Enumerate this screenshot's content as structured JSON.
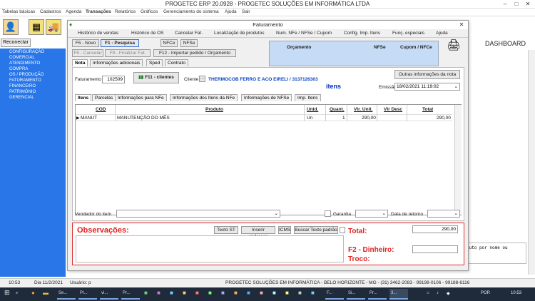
{
  "app": {
    "title": "PROGETEC ERP 20.0928 - PROGETEC SOLUÇÕES EM INFORMÁTICA LTDA",
    "menu": [
      "Tabelas básicas",
      "Cadastros",
      "Agenda",
      "Transações",
      "Relatórios",
      "Gráficos",
      "Gerenciamento do sistema",
      "Ajuda",
      "Sair"
    ],
    "reconnect_label": "Reconectar",
    "modules": [
      "CONFIGURAÇÃO",
      "COMERCIAL",
      "ATENDIMENTO",
      "COMPRA",
      "OS / PRODUÇÃO",
      "FATURAMENTO",
      "FINANCEIRO",
      "PATRIMÔNIO",
      "GERENCIAL"
    ],
    "dashboard_label": "DASHBOARD",
    "search_hint": "duto por nome ou"
  },
  "dialog": {
    "title": "Faturamento",
    "menu": [
      "Histórico de vendas",
      "Histórico de OS",
      "Cancelar Fat.",
      "Localização de produtos",
      "Num. NFe / NFSe / Cupom",
      "Config. Imp. Itens",
      "Funç. especiais",
      "Ajuda"
    ],
    "buttons": {
      "novo": "F5 - Novo",
      "pesquisa": "F1 - Pesquisa",
      "nfce": "NFCe",
      "nfse": "NFSe",
      "cancelar": "F8 - Cancelar",
      "finalizar": "F9 - Finalizar Fat.",
      "importar": "F12 - Importar pedido / Orçamento",
      "clientes": "F11 - clientes",
      "outras_info": "Outras informações da nota",
      "cliente_lookup": "...",
      "texto_st": "Texto ST",
      "inserir_endereco": "Inserir endereço",
      "icms": "ICMS",
      "buscar_texto": "Buscar Texto padrão"
    },
    "summary_headers": [
      "Orçamento",
      "NFSe",
      "Cupom / NFCe"
    ],
    "main_tabs": [
      "Nota",
      "Informações adicionais",
      "Sped",
      "Contrato"
    ],
    "faturamento_label": "Faturamento",
    "faturamento_number": "102509",
    "cliente_label": "Cliente",
    "cliente_name": "THERMOCOB FERRO E ACO EIRELI / 3137126303",
    "itens_title": "itens",
    "emissao_label": "Emissão",
    "emissao_value": "18/02/2021 11:19:02",
    "item_tabs": [
      "Itens",
      "Parcelas",
      "Informações para NFe",
      "Informações dos Itens da NFe",
      "Informações de NFSe",
      "Imp. Itens"
    ],
    "grid": {
      "headers": [
        "COD",
        "Produto",
        "Unid.",
        "Quant.",
        "Vlr. Unit.",
        "Vlr Desc",
        "Total"
      ],
      "row": {
        "cod": "MANUT",
        "produto": "MANUTENÇÃO DO MÊS",
        "unid": "Un",
        "quant": "1",
        "vlr_unit": "290,00",
        "vlr_desc": "",
        "total": "290,00"
      }
    },
    "vendedor_label": "Vendedor do item",
    "garantia_label": "Garantia",
    "data_retorno_label": "Data de retorno",
    "observacoes_label": "Observações:",
    "total_label": "Total:",
    "total_value": "290,00",
    "dinheiro_label": "F2 - Dinheiro:",
    "troco_label": "Troco:"
  },
  "statusbar": {
    "time": "10:53",
    "date": "Dia 11/2/2021",
    "user": "Usuário: p",
    "company": "PROGETEC SOLUÇÕES EM INFORMÁTICA - BELO HORIZONTE - MG - (31) 3462-2083 - 99198-0106 - 99188-6116"
  },
  "taskbar": {
    "items": [
      "Se...",
      "Pr...",
      "vi...",
      "Pr...",
      "F...",
      "Si...",
      "Pr...",
      "3..."
    ],
    "lang": "POR",
    "clock": "10:53"
  }
}
